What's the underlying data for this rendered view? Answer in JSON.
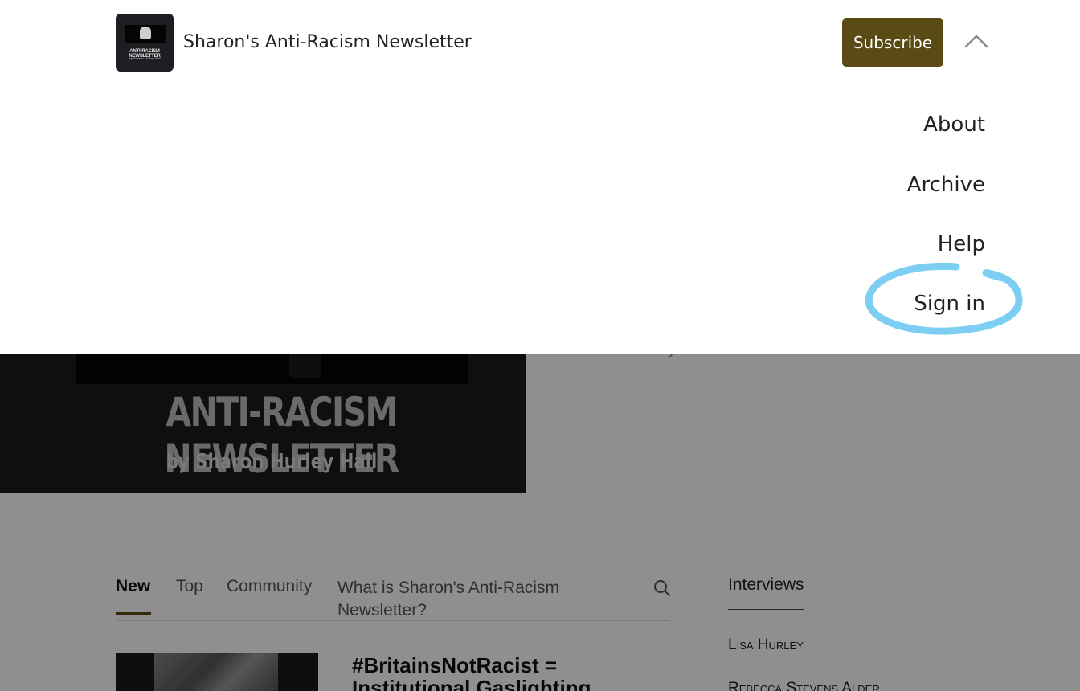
{
  "header": {
    "site_title": "Sharon's Anti-Racism Newsletter",
    "subscribe_label": "Subscribe",
    "logo_text": "ANTI-RACISM NEWSLETTER",
    "logo_by": "by Sharon Hurley Hall"
  },
  "menu": {
    "items": [
      {
        "label": "About"
      },
      {
        "label": "Archive"
      },
      {
        "label": "Help"
      },
      {
        "label": "Sign in"
      }
    ],
    "highlight_color": "#7ccff2"
  },
  "hero": {
    "title": "ANTI-RACISM NEWSLETTER",
    "subtitle": "by Sharon Hurley Hall",
    "meta_author": "Sharon Hurley Hall"
  },
  "tabs": [
    {
      "label": "New",
      "active": true
    },
    {
      "label": "Top",
      "active": false
    },
    {
      "label": "Community",
      "active": false
    },
    {
      "label": "What is Sharon's Anti-Racism Newsletter?",
      "active": false
    }
  ],
  "sidebar": {
    "heading": "Interviews",
    "items": [
      "Lisa Hurley",
      "Rebecca Stevens Alder"
    ]
  },
  "post": {
    "title": "#BritainsNotRacist = Institutional Gaslighting"
  },
  "colors": {
    "accent": "#5a4a14",
    "overlay": "rgba(0,0,0,0.44)"
  }
}
